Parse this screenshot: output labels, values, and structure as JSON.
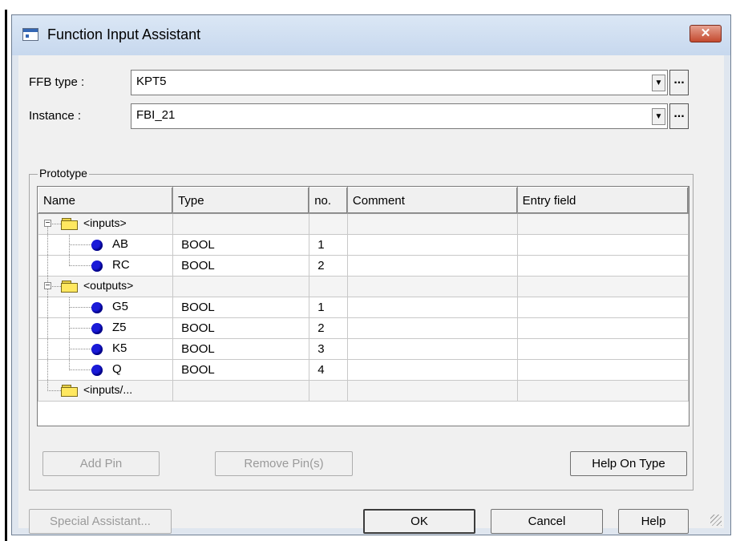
{
  "window": {
    "title": "Function Input Assistant",
    "close_glyph": "✕"
  },
  "fields": {
    "ffb_type_label": "FFB type :",
    "ffb_type_value": "KPT5",
    "instance_label": "Instance :",
    "instance_value": "FBI_21",
    "browse_label": "...",
    "dropdown_glyph": "▼"
  },
  "prototype": {
    "group_label": "Prototype",
    "columns": [
      "Name",
      "Type",
      "no.",
      "Comment",
      "Entry field"
    ],
    "rows": [
      {
        "kind": "folder",
        "name": "<inputs>",
        "type": "",
        "no": "",
        "comment": "",
        "entry": "",
        "expander": "−"
      },
      {
        "kind": "leaf",
        "name": "AB",
        "type": "BOOL",
        "no": "1",
        "comment": "",
        "entry": ""
      },
      {
        "kind": "leaf",
        "name": "RC",
        "type": "BOOL",
        "no": "2",
        "comment": "",
        "entry": ""
      },
      {
        "kind": "folder",
        "name": "<outputs>",
        "type": "",
        "no": "",
        "comment": "",
        "entry": "",
        "expander": "−"
      },
      {
        "kind": "leaf",
        "name": "G5",
        "type": "BOOL",
        "no": "1",
        "comment": "",
        "entry": ""
      },
      {
        "kind": "leaf",
        "name": "Z5",
        "type": "BOOL",
        "no": "2",
        "comment": "",
        "entry": ""
      },
      {
        "kind": "leaf",
        "name": "K5",
        "type": "BOOL",
        "no": "3",
        "comment": "",
        "entry": ""
      },
      {
        "kind": "leaf",
        "name": "Q",
        "type": "BOOL",
        "no": "4",
        "comment": "",
        "entry": ""
      },
      {
        "kind": "folder",
        "name": "<inputs/...",
        "type": "",
        "no": "",
        "comment": "",
        "entry": "",
        "expander": ""
      }
    ],
    "add_pin_label": "Add Pin",
    "remove_pin_label": "Remove Pin(s)",
    "help_on_type_label": "Help On Type"
  },
  "footer": {
    "special_assistant_label": "Special Assistant...",
    "ok_label": "OK",
    "cancel_label": "Cancel",
    "help_label": "Help"
  },
  "colors": {
    "pin_dot": "#1a1ad8",
    "folder": "#ffe860",
    "close_button": "#c44a2f"
  }
}
